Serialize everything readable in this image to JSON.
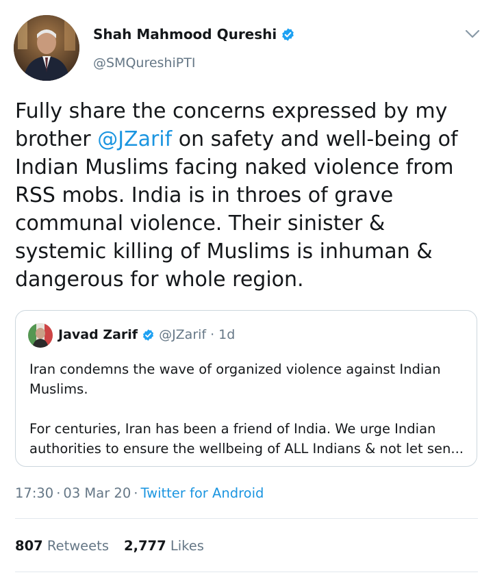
{
  "tweet": {
    "author": {
      "name": "Shah Mahmood Qureshi",
      "handle": "@SMQureshiPTI",
      "verified": true
    },
    "text": {
      "part1": "Fully share the concerns expressed by my brother ",
      "mention": "@JZarif",
      "part2": " on safety and well-being of Indian Muslims facing naked violence from RSS mobs. India is in throes of grave communal violence. Their sinister & systemic killing of Muslims is inhuman & dangerous for whole region."
    },
    "quoted": {
      "name": "Javad Zarif",
      "verified": true,
      "handle": "@JZarif",
      "separator": "·",
      "time": "1d",
      "paragraph1": "Iran condemns the wave of organized violence against Indian Muslims.",
      "paragraph2": "For centuries, Iran has been a friend of India. We urge Indian authorities to ensure the wellbeing of ALL Indians & not let sen..."
    },
    "meta": {
      "time": "17:30",
      "date": "03 Mar 20",
      "separator": "·",
      "source": "Twitter for Android"
    },
    "stats": {
      "retweets_count": "807",
      "retweets_label": "Retweets",
      "likes_count": "2,777",
      "likes_label": "Likes"
    }
  },
  "icons": {
    "verified": "verified-badge-icon",
    "more": "chevron-down-icon"
  },
  "colors": {
    "link": "#1b95e0",
    "secondary_text": "#657786",
    "primary_text": "#14171a",
    "verified": "#1da1f2",
    "border": "#e1e8ed"
  }
}
